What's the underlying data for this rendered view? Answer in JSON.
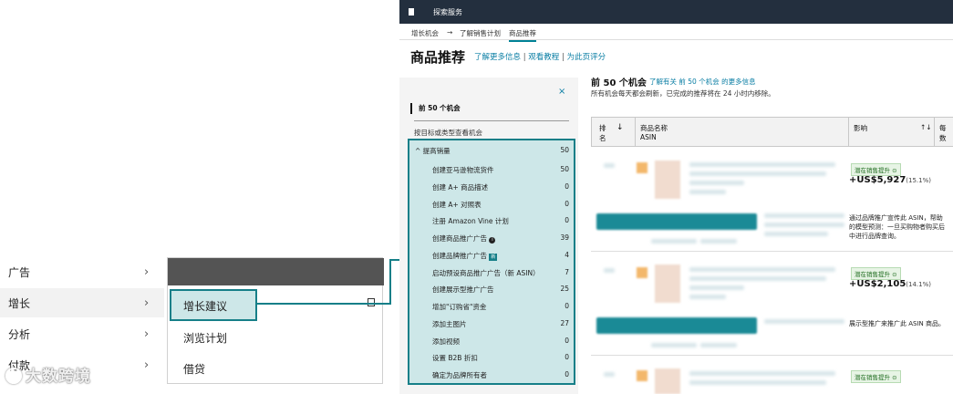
{
  "left_menu": {
    "items": [
      {
        "label": "广告",
        "chevron": "›"
      },
      {
        "label": "增长",
        "chevron": "›"
      },
      {
        "label": "分析",
        "chevron": "›"
      },
      {
        "label": "付款",
        "chevron": "›"
      }
    ]
  },
  "submenu": {
    "items": [
      {
        "label": "增长建议"
      },
      {
        "label": "浏览计划"
      },
      {
        "label": "借贷"
      }
    ]
  },
  "panel": {
    "topbar_title": "探索服务",
    "breadcrumb": {
      "item1": "增长机会",
      "arrow": "→",
      "item2": "了解销售计划",
      "item3": "商品推荐"
    },
    "page_title": "商品推荐",
    "title_links": {
      "learn_more": "了解更多信息",
      "sep": " | ",
      "tutorial": "观看教程",
      "rate": "为此页评分"
    },
    "filter": {
      "close": "×",
      "top_label": "前 50 个机会",
      "sub_label": "按目标或类型查看机会",
      "group_label": "^ 提高销量",
      "group_count": "50",
      "rows": [
        {
          "label": "创建亚马逊物流货件",
          "count": "50"
        },
        {
          "label": "创建 A+ 商品描述",
          "count": "0"
        },
        {
          "label": "创建 A+ 对照表",
          "count": "0"
        },
        {
          "label": "注册 Amazon Vine 计划",
          "count": "0"
        },
        {
          "label": "创建商品推广广告",
          "count": "39"
        },
        {
          "label": "创建品牌推广广告",
          "count": "4"
        },
        {
          "label": "启动预设商品推广广告（新 ASIN）",
          "count": "7"
        },
        {
          "label": "创建展示型推广广告",
          "count": "25"
        },
        {
          "label": "增加\"订购省\"资金",
          "count": "0"
        },
        {
          "label": "添加主图片",
          "count": "27"
        },
        {
          "label": "添加视频",
          "count": "0"
        },
        {
          "label": "设置 B2B 折扣",
          "count": "0"
        },
        {
          "label": "确定为品牌所有者",
          "count": "0"
        }
      ],
      "info_icon_text": "i",
      "new_badge_text": "新"
    },
    "opportunities": {
      "title": "前 50 个机会",
      "link": "了解有关 前 50 个机会 的更多信息",
      "note": "所有机会每天都会刷新，已完成的推荐将在 24 小时内移除。",
      "headers": {
        "rank_line1": "排",
        "rank_line2": "名",
        "sort_arrow": "↓",
        "product": "商品名称",
        "asin": "ASIN",
        "impact": "影响",
        "impact_sort": "↑↓",
        "extra1": "每",
        "extra2": "数"
      },
      "rows": [
        {
          "badge": "潜在销售提升 ⊙",
          "amount": "+US$5,927",
          "pct": "(15.1%)",
          "desc1": "通过品牌推广宣传此 ASIN，帮助",
          "desc2": "的模型预测：一旦买购物者购买后",
          "desc3": "中进行品牌查询。"
        },
        {
          "badge": "潜在销售提升 ⊙",
          "amount": "+US$2,105",
          "pct": "(14.1%)",
          "desc1": "展示型推广来推广此 ASIN 商品。"
        },
        {
          "badge": "潜在销售提升 ⊙"
        }
      ]
    }
  },
  "watermark": "大数跨境"
}
